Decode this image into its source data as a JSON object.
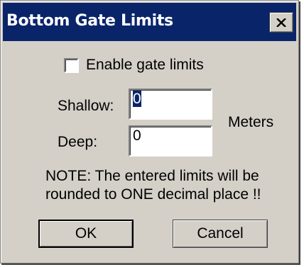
{
  "window": {
    "title": "Bottom Gate Limits",
    "close_icon": "close-icon"
  },
  "gate": {
    "enable_label": "Enable gate limits",
    "enabled": false
  },
  "limits": {
    "shallow_label": "Shallow:",
    "shallow_value": "0",
    "deep_label": "Deep:",
    "deep_value": "0",
    "unit_label": "Meters"
  },
  "note": {
    "line1": "NOTE:  The entered limits will be",
    "line2": "rounded to ONE decimal place !!"
  },
  "buttons": {
    "ok_label": "OK",
    "cancel_label": "Cancel"
  },
  "colors": {
    "titlebar": "#0a246a",
    "face": "#d4d0c8",
    "selection": "#0a246a"
  }
}
